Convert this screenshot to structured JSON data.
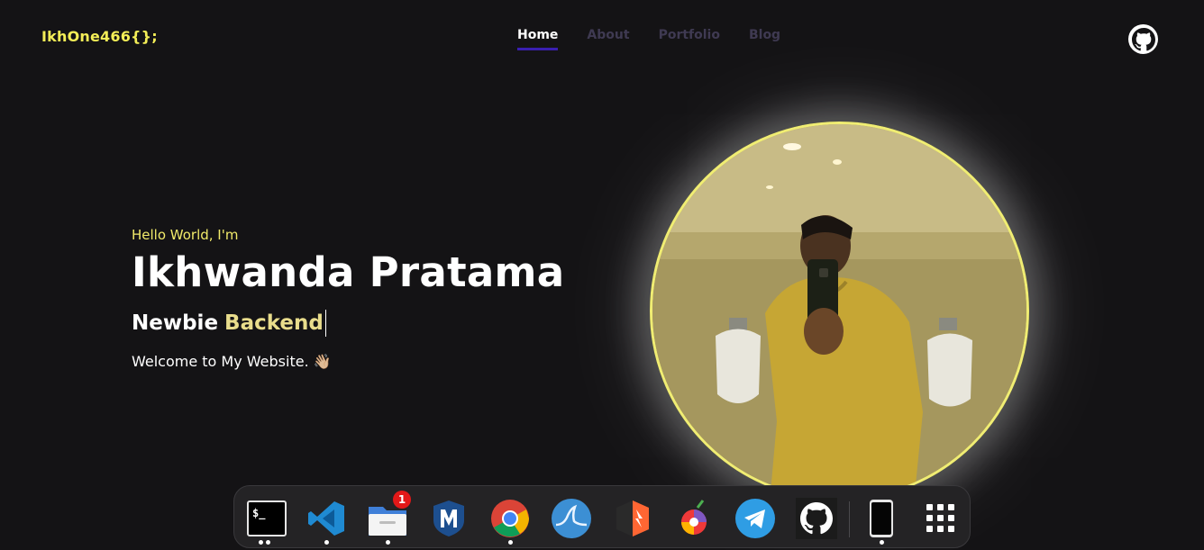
{
  "header": {
    "logo": "IkhOne466{};",
    "nav": [
      {
        "label": "Home",
        "active": true
      },
      {
        "label": "About",
        "active": false
      },
      {
        "label": "Portfolio",
        "active": false
      },
      {
        "label": "Blog",
        "active": false
      }
    ],
    "github_icon": "github-icon"
  },
  "hero": {
    "greeting": "Hello World, I'm",
    "name": "Ikhwanda Pratama",
    "role_prefix": "Newbie",
    "role_highlight": "Backend",
    "welcome": "Welcome to My Website. 👋🏼"
  },
  "dock": {
    "items": [
      {
        "name": "terminal",
        "running": true
      },
      {
        "name": "vscode",
        "running": true
      },
      {
        "name": "files",
        "running": true,
        "badge": "1"
      },
      {
        "name": "metasploit",
        "running": false
      },
      {
        "name": "chrome",
        "running": true
      },
      {
        "name": "wireshark",
        "running": false
      },
      {
        "name": "burpsuite",
        "running": false
      },
      {
        "name": "vivaldi",
        "running": false
      },
      {
        "name": "telegram",
        "running": false
      },
      {
        "name": "github-desktop",
        "running": false
      },
      {
        "name": "phone",
        "running": true
      },
      {
        "name": "app-grid",
        "running": false
      }
    ]
  },
  "colors": {
    "background": "#141315",
    "logo": "#f4ee57",
    "nav_active_underline": "#3a1fb0",
    "nav_inactive": "#3f3a52",
    "greeting": "#f1ea6a",
    "photo_ring": "#f0ed73"
  }
}
